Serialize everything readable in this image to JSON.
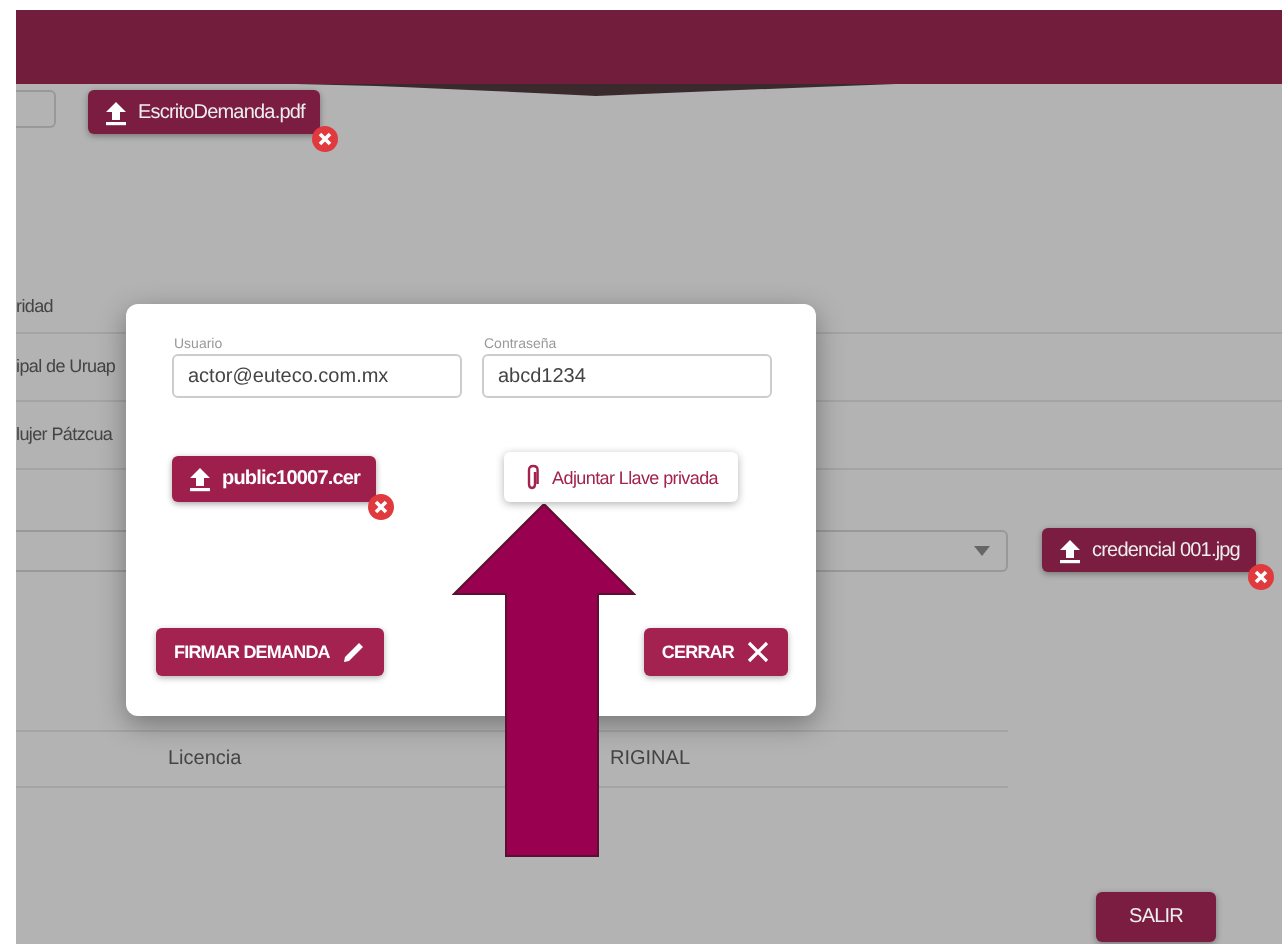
{
  "page": {
    "top_attachment": {
      "filename": "EscritoDemanda.pdf"
    },
    "list_items": [
      "ridad",
      "ipal de Uruap",
      "lujer Pátzcua"
    ],
    "side_attachment": {
      "filename": "credencial 001.jpg"
    },
    "table_rows": [
      {
        "column_1": "Licencia",
        "column_2": "RIGINAL"
      }
    ],
    "exit_button": "SALIR"
  },
  "dialog": {
    "fields": [
      {
        "label": "Usuario",
        "value": "actor@euteco.com.mx"
      },
      {
        "label": "Contraseña",
        "value": "abcd1234"
      }
    ],
    "certificate": {
      "filename": "public10007.cer"
    },
    "attach_button": "Adjuntar Llave privada",
    "sign_button": "FIRMAR DEMANDA",
    "close_button": "CERRAR"
  }
}
